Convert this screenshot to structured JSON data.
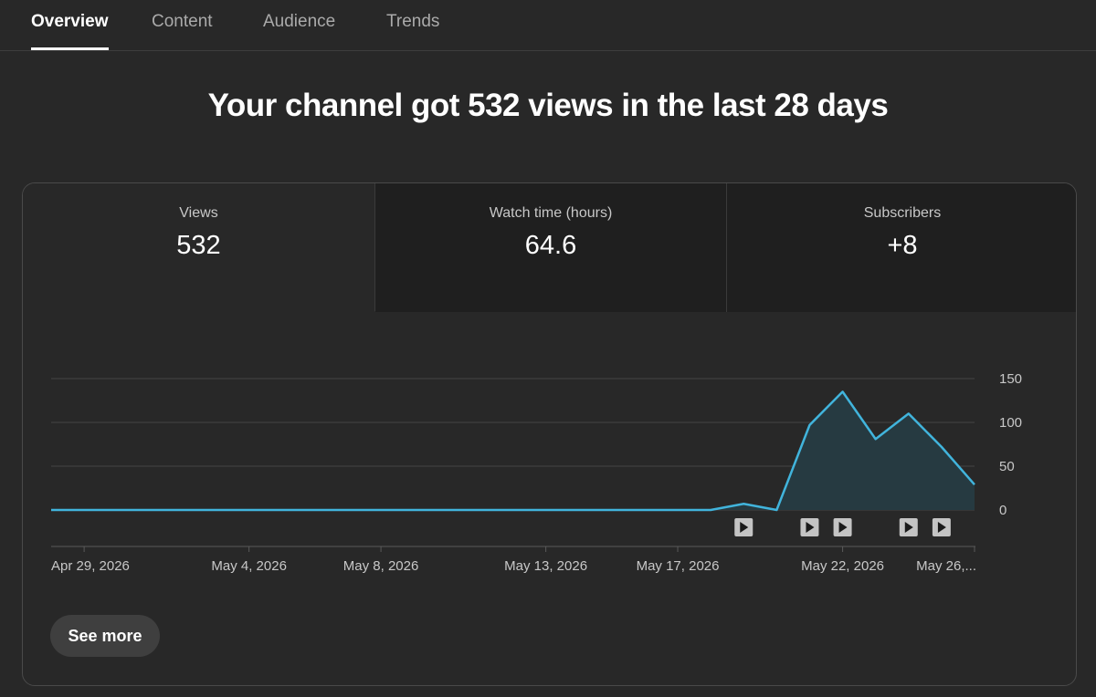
{
  "tabs": [
    {
      "label": "Overview",
      "active": true
    },
    {
      "label": "Content",
      "active": false
    },
    {
      "label": "Audience",
      "active": false
    },
    {
      "label": "Trends",
      "active": false
    }
  ],
  "headline": "Your channel got 532 views in the last 28 days",
  "metrics": [
    {
      "label": "Views",
      "value": "532"
    },
    {
      "label": "Watch time (hours)",
      "value": "64.6"
    },
    {
      "label": "Subscribers",
      "value": "+8"
    }
  ],
  "see_more_label": "See more",
  "colors": {
    "line": "#41b4dc",
    "area": "#263a41",
    "grid": "#434343"
  },
  "chart_data": {
    "type": "area",
    "x": [
      "Apr 28, 2026",
      "Apr 29, 2026",
      "Apr 30, 2026",
      "May 1, 2026",
      "May 2, 2026",
      "May 3, 2026",
      "May 4, 2026",
      "May 5, 2026",
      "May 6, 2026",
      "May 7, 2026",
      "May 8, 2026",
      "May 9, 2026",
      "May 10, 2026",
      "May 11, 2026",
      "May 12, 2026",
      "May 13, 2026",
      "May 14, 2026",
      "May 15, 2026",
      "May 16, 2026",
      "May 17, 2026",
      "May 18, 2026",
      "May 19, 2026",
      "May 20, 2026",
      "May 21, 2026",
      "May 22, 2026",
      "May 23, 2026",
      "May 24, 2026",
      "May 25, 2026",
      "May 26, 2026"
    ],
    "values": [
      0,
      0,
      0,
      0,
      0,
      0,
      0,
      0,
      0,
      0,
      0,
      0,
      0,
      0,
      0,
      0,
      0,
      0,
      0,
      0,
      0,
      7,
      0,
      97,
      135,
      81,
      110,
      72,
      29
    ],
    "yticks": [
      0,
      50,
      100,
      150
    ],
    "ylim": [
      0,
      150
    ],
    "xtick_labels": [
      {
        "label": "Apr 29, 2026",
        "date": "Apr 29, 2026"
      },
      {
        "label": "May 4, 2026",
        "date": "May 4, 2026"
      },
      {
        "label": "May 8, 2026",
        "date": "May 8, 2026"
      },
      {
        "label": "May 13, 2026",
        "date": "May 13, 2026"
      },
      {
        "label": "May 17, 2026",
        "date": "May 17, 2026"
      },
      {
        "label": "May 22, 2026",
        "date": "May 22, 2026"
      },
      {
        "label": "May 26,...",
        "date": "May 26, 2026"
      }
    ],
    "video_markers": [
      "May 19, 2026",
      "May 21, 2026",
      "May 22, 2026",
      "May 24, 2026",
      "May 25, 2026"
    ],
    "grid": true,
    "y_axis_position": "right"
  }
}
